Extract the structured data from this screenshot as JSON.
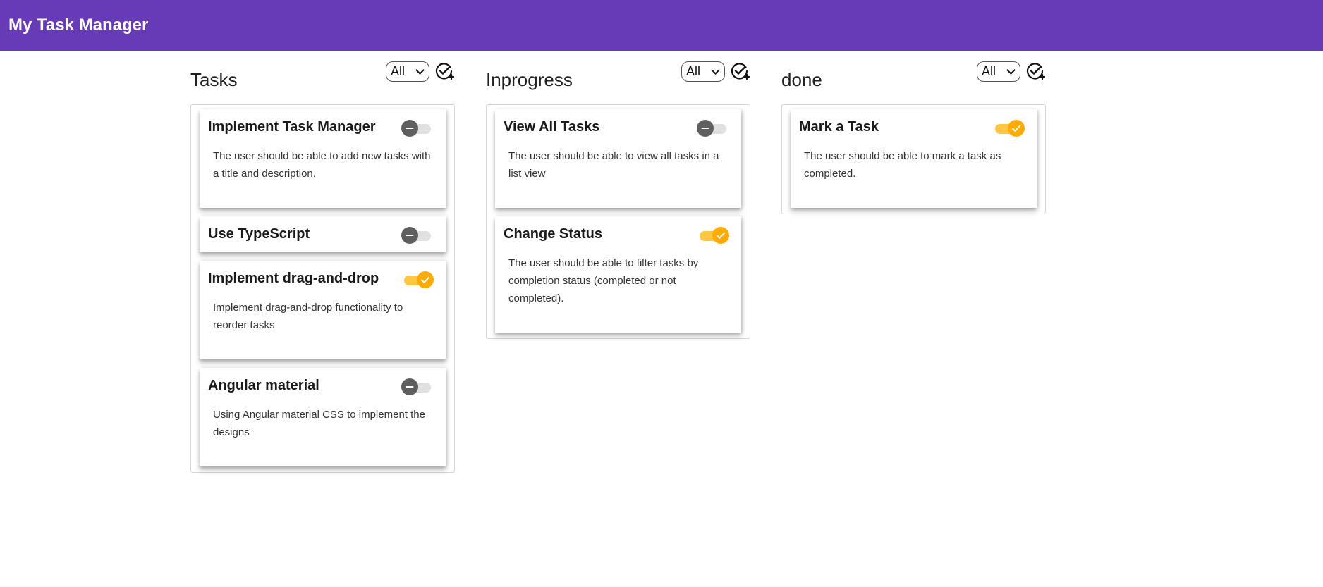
{
  "app": {
    "title": "My Task Manager"
  },
  "colors": {
    "toolbar": "#673ab7",
    "toggle_on_thumb": "#ffab00",
    "toggle_on_track": "#ffc740",
    "toggle_off_thumb": "#5f5f5f",
    "toggle_off_track": "#e0e0e0"
  },
  "columns": [
    {
      "title": "Tasks",
      "filter": {
        "selected": "All"
      },
      "add_icon": "add-task-icon",
      "cards": [
        {
          "title": "Implement Task Manager",
          "description": "The user should be able to add new tasks with a title and description.",
          "completed": false
        },
        {
          "title": "Use TypeScript",
          "description": "",
          "completed": false
        },
        {
          "title": "Implement drag-and-drop",
          "description": "Implement drag-and-drop functionality to reorder tasks",
          "completed": true
        },
        {
          "title": "Angular material",
          "description": "Using Angular material CSS to implement the designs",
          "completed": false
        }
      ]
    },
    {
      "title": "Inprogress",
      "filter": {
        "selected": "All"
      },
      "add_icon": "add-task-icon",
      "cards": [
        {
          "title": "View All Tasks",
          "description": "The user should be able to view all tasks in a list view",
          "completed": false
        },
        {
          "title": "Change Status",
          "description": "The user should be able to filter tasks by completion status (completed or not completed).",
          "completed": true
        }
      ]
    },
    {
      "title": "done",
      "filter": {
        "selected": "All"
      },
      "add_icon": "add-task-icon",
      "cards": [
        {
          "title": "Mark a Task",
          "description": "The user should be able to mark a task as completed.",
          "completed": true
        }
      ]
    }
  ]
}
